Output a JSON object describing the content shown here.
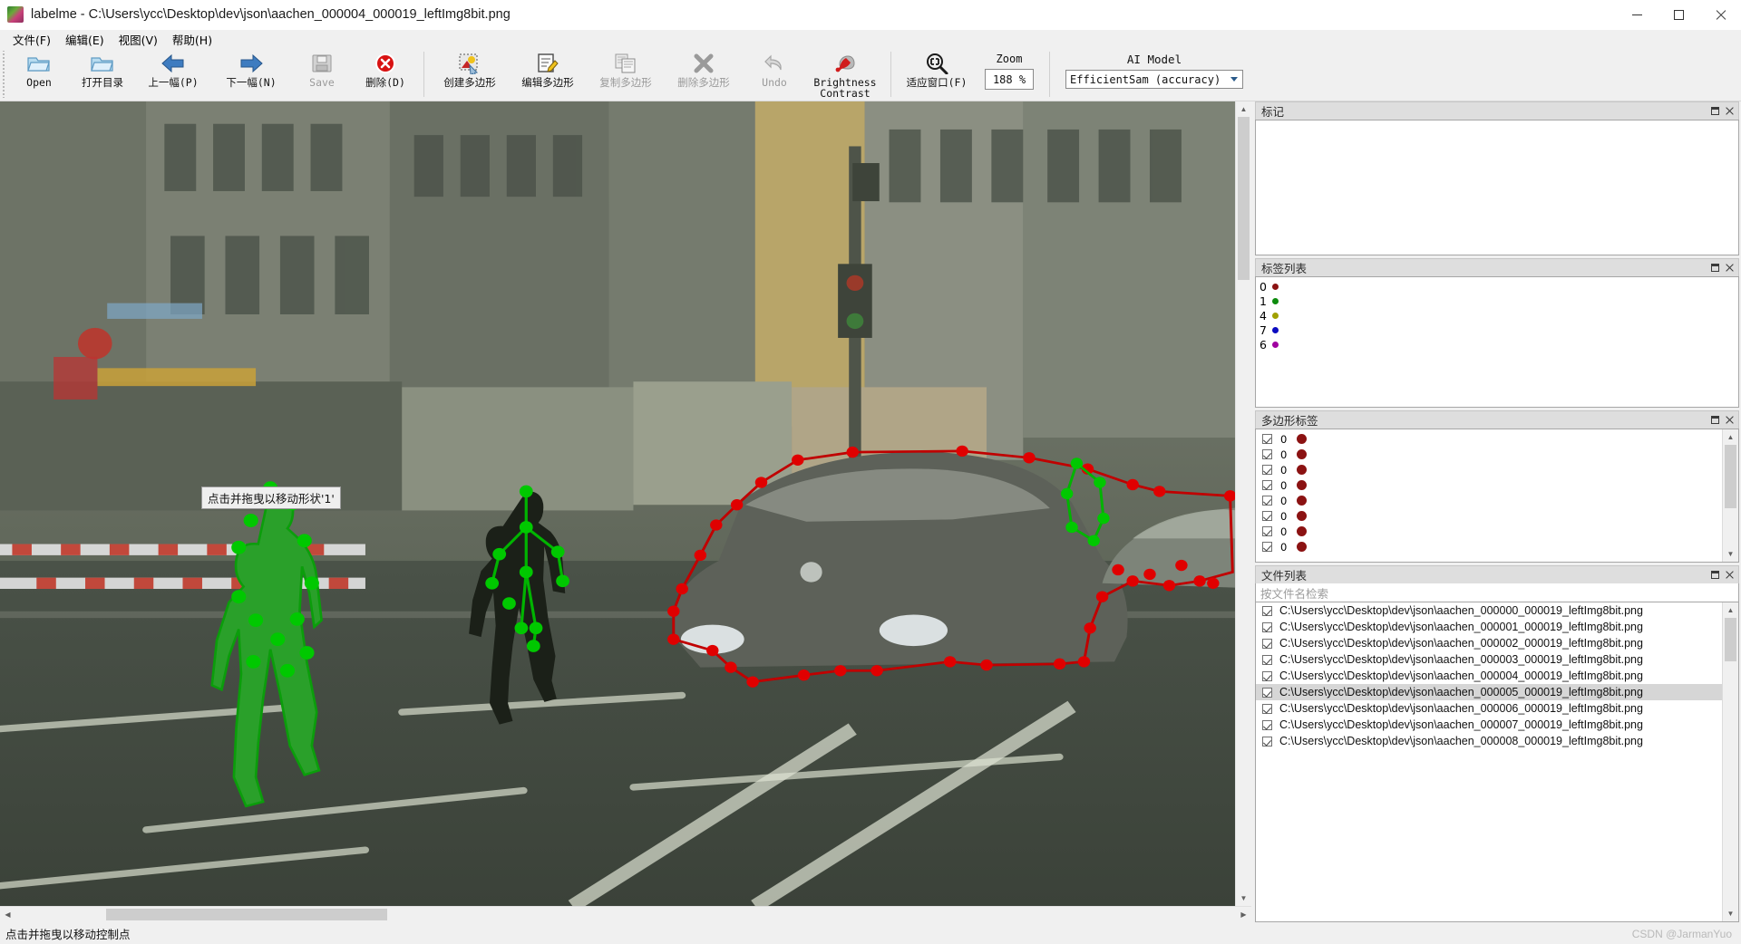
{
  "window": {
    "app_name": "labelme",
    "title": "labelme - C:\\Users\\ycc\\Desktop\\dev\\json\\aachen_000004_000019_leftImg8bit.png",
    "minimize": "—",
    "maximize": "□",
    "close": "✕"
  },
  "menu": [
    {
      "label": "文件(F)"
    },
    {
      "label": "编辑(E)"
    },
    {
      "label": "视图(V)"
    },
    {
      "label": "帮助(H)"
    }
  ],
  "toolbar": {
    "tools": [
      {
        "name": "open",
        "label": "Open",
        "icon": "open-folder-icon",
        "disabled": false
      },
      {
        "name": "open-dir",
        "label": "打开目录",
        "icon": "open-folder-icon",
        "disabled": false
      },
      {
        "name": "prev-image",
        "label": "上一幅(P)",
        "icon": "arrow-left-icon",
        "disabled": false
      },
      {
        "name": "next-image",
        "label": "下一幅(N)",
        "icon": "arrow-right-icon",
        "disabled": false
      },
      {
        "name": "save",
        "label": "Save",
        "icon": "floppy-disk-icon",
        "disabled": true
      },
      {
        "name": "delete-file",
        "label": "删除(D)",
        "icon": "delete-circle-icon",
        "disabled": false
      }
    ],
    "shape_tools": [
      {
        "name": "create-polygon",
        "label": "创建多边形",
        "icon": "create-polygon-icon",
        "disabled": false
      },
      {
        "name": "edit-polygon",
        "label": "编辑多边形",
        "icon": "edit-polygon-icon",
        "disabled": false
      },
      {
        "name": "duplicate-polygon",
        "label": "复制多边形",
        "icon": "copy-polygon-icon",
        "disabled": true
      },
      {
        "name": "delete-polygon",
        "label": "删除多边形",
        "icon": "delete-x-icon",
        "disabled": true
      },
      {
        "name": "undo",
        "label": "Undo",
        "icon": "undo-arrow-icon",
        "disabled": true
      },
      {
        "name": "brightness-contrast",
        "label": "Brightness\nContrast",
        "icon": "brightness-icon",
        "disabled": false
      }
    ],
    "view_tools": [
      {
        "name": "fit-window",
        "label": "适应窗口(F)",
        "icon": "zoom-fit-icon",
        "disabled": false
      }
    ],
    "zoom": {
      "caption": "Zoom",
      "value": "188 %"
    },
    "ai_model": {
      "caption": "AI Model",
      "value": "EfficientSam (accuracy)"
    }
  },
  "panels": {
    "flags": {
      "title": "标记",
      "items": []
    },
    "label_list": {
      "title": "标签列表",
      "items": [
        {
          "label": "0",
          "color": "#8b1212"
        },
        {
          "label": "1",
          "color": "#0d8b0d"
        },
        {
          "label": "4",
          "color": "#a0a000"
        },
        {
          "label": "7",
          "color": "#0b0bc0"
        },
        {
          "label": "6",
          "color": "#a000a0"
        }
      ]
    },
    "polygon_labels": {
      "title": "多边形标签",
      "items": [
        {
          "checked": true,
          "label": "0",
          "color": "#8b1212"
        },
        {
          "checked": true,
          "label": "0",
          "color": "#8b1212"
        },
        {
          "checked": true,
          "label": "0",
          "color": "#8b1212"
        },
        {
          "checked": true,
          "label": "0",
          "color": "#8b1212"
        },
        {
          "checked": true,
          "label": "0",
          "color": "#8b1212"
        },
        {
          "checked": true,
          "label": "0",
          "color": "#8b1212"
        },
        {
          "checked": true,
          "label": "0",
          "color": "#8b1212"
        },
        {
          "checked": true,
          "label": "0",
          "color": "#8b1212"
        }
      ]
    },
    "file_list": {
      "title": "文件列表",
      "search_placeholder": "按文件名检索",
      "search_value": "",
      "items": [
        {
          "checked": true,
          "path": "C:\\Users\\ycc\\Desktop\\dev\\json\\aachen_000000_000019_leftImg8bit.png",
          "selected": false
        },
        {
          "checked": true,
          "path": "C:\\Users\\ycc\\Desktop\\dev\\json\\aachen_000001_000019_leftImg8bit.png",
          "selected": false
        },
        {
          "checked": true,
          "path": "C:\\Users\\ycc\\Desktop\\dev\\json\\aachen_000002_000019_leftImg8bit.png",
          "selected": false
        },
        {
          "checked": true,
          "path": "C:\\Users\\ycc\\Desktop\\dev\\json\\aachen_000003_000019_leftImg8bit.png",
          "selected": false
        },
        {
          "checked": true,
          "path": "C:\\Users\\ycc\\Desktop\\dev\\json\\aachen_000004_000019_leftImg8bit.png",
          "selected": false
        },
        {
          "checked": true,
          "path": "C:\\Users\\ycc\\Desktop\\dev\\json\\aachen_000005_000019_leftImg8bit.png",
          "selected": true
        },
        {
          "checked": true,
          "path": "C:\\Users\\ycc\\Desktop\\dev\\json\\aachen_000006_000019_leftImg8bit.png",
          "selected": false
        },
        {
          "checked": true,
          "path": "C:\\Users\\ycc\\Desktop\\dev\\json\\aachen_000007_000019_leftImg8bit.png",
          "selected": false
        },
        {
          "checked": true,
          "path": "C:\\Users\\ycc\\Desktop\\dev\\json\\aachen_000008_000019_leftImg8bit.png",
          "selected": false
        }
      ]
    }
  },
  "canvas": {
    "tooltip": "点击并拖曳以移动形状'1'",
    "shape_colors": {
      "polygon_red": "#c00000",
      "polygon_green": "#00b400",
      "vertex_red": "#e00000",
      "vertex_green": "#00c800"
    }
  },
  "statusbar": {
    "message": "点击并拖曳以移动控制点",
    "watermark": "CSDN @JarmanYuo"
  }
}
